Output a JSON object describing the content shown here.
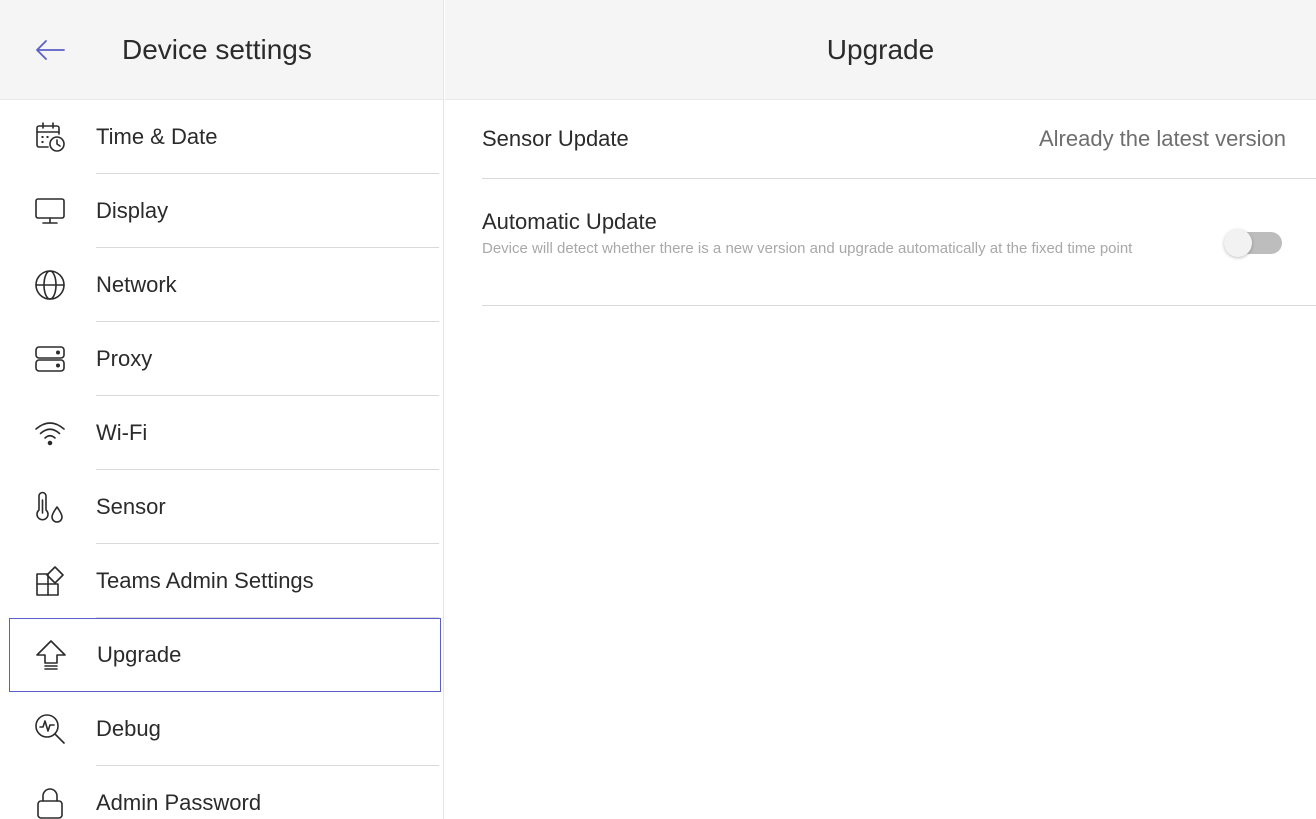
{
  "sidebar": {
    "title": "Device settings",
    "items": [
      {
        "label": "Time & Date",
        "icon": "calendar-clock-icon"
      },
      {
        "label": "Display",
        "icon": "monitor-icon"
      },
      {
        "label": "Network",
        "icon": "globe-icon"
      },
      {
        "label": "Proxy",
        "icon": "server-icon"
      },
      {
        "label": "Wi-Fi",
        "icon": "wifi-icon"
      },
      {
        "label": "Sensor",
        "icon": "thermometer-drop-icon"
      },
      {
        "label": "Teams Admin Settings",
        "icon": "apps-icon"
      },
      {
        "label": "Upgrade",
        "icon": "upgrade-arrow-icon",
        "selected": true
      },
      {
        "label": "Debug",
        "icon": "debug-magnifier-icon"
      },
      {
        "label": "Admin Password",
        "icon": "lock-icon"
      }
    ]
  },
  "main": {
    "title": "Upgrade",
    "sensor_update": {
      "label": "Sensor Update",
      "status": "Already the latest version"
    },
    "automatic_update": {
      "label": "Automatic Update",
      "description": "Device will detect whether there is a new version and upgrade automatically at the fixed time point",
      "enabled": false
    }
  },
  "colors": {
    "header_bg": "#f5f5f5",
    "selection_border": "#5b5fc7",
    "divider": "#d9d9d9",
    "muted_text": "#a8a8a8",
    "toggle_off": "#bdbdbd"
  }
}
